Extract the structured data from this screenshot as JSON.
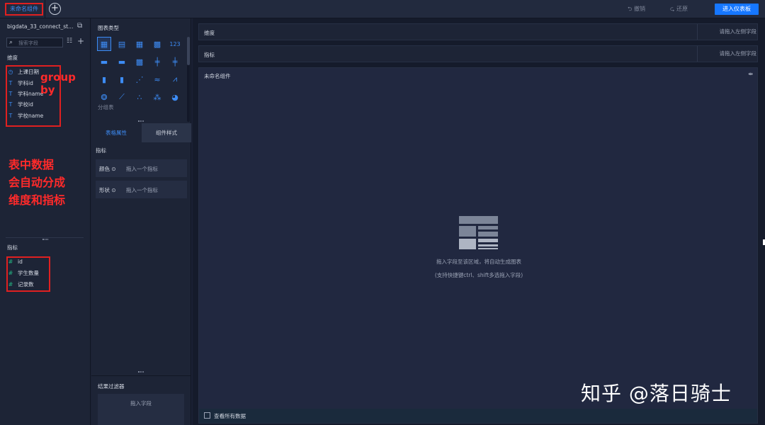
{
  "topbar": {
    "active_tab": "未命名组件",
    "add_tab_icon": "+",
    "undo_label": "撤销",
    "redo_label": "还原",
    "enter_dashboard_label": "进入仪表板"
  },
  "left": {
    "dataset_name": "bigdata_33_connect_stud...",
    "search_placeholder": "搜索字段",
    "dimension_title": "维度",
    "dimensions": [
      {
        "label": "上课日期",
        "icon": "clock-icon"
      },
      {
        "label": "学科id",
        "icon": "text-type-icon"
      },
      {
        "label": "学科name",
        "icon": "text-type-icon"
      },
      {
        "label": "学校id",
        "icon": "text-type-icon"
      },
      {
        "label": "学校name",
        "icon": "text-type-icon"
      }
    ],
    "measure_title": "指标",
    "measures": [
      {
        "label": "id",
        "icon": "number-type-icon"
      },
      {
        "label": "学生数量",
        "icon": "number-type-icon"
      },
      {
        "label": "记录数",
        "icon": "number-type-icon"
      }
    ],
    "annotation_groupby": "group by",
    "annotation_note": [
      "表中数据",
      "会自动分成",
      "维度和指标"
    ]
  },
  "middle": {
    "chart_type_title": "图表类型",
    "chart_types": [
      {
        "icon": "group-table-icon",
        "glyph": "▦",
        "selected": true
      },
      {
        "icon": "detail-table-icon",
        "glyph": "▤",
        "selected": false
      },
      {
        "icon": "cross-table-icon",
        "glyph": "▦",
        "selected": false
      },
      {
        "icon": "color-table-icon",
        "glyph": "▩",
        "selected": false
      },
      {
        "icon": "kpi-icon",
        "glyph": "123",
        "selected": false
      },
      {
        "icon": "gantt-icon",
        "glyph": "▬",
        "selected": false
      },
      {
        "icon": "heat-table-icon",
        "glyph": "▬",
        "selected": false
      },
      {
        "icon": "heatmap-icon",
        "glyph": "▩",
        "selected": false
      },
      {
        "icon": "boxplot-icon",
        "glyph": "╪",
        "selected": false
      },
      {
        "icon": "candle-icon",
        "glyph": "╪",
        "selected": false
      },
      {
        "icon": "bar-chart-icon",
        "glyph": "▮",
        "selected": false
      },
      {
        "icon": "stacked-bar-icon",
        "glyph": "▮",
        "selected": false
      },
      {
        "icon": "scatter-bar-icon",
        "glyph": "⋰",
        "selected": false
      },
      {
        "icon": "multi-line-icon",
        "glyph": "≈",
        "selected": false
      },
      {
        "icon": "line-chart-icon",
        "glyph": "⩘",
        "selected": false
      },
      {
        "icon": "radar-icon",
        "glyph": "❂",
        "selected": false
      },
      {
        "icon": "area-chart-icon",
        "glyph": "⟋",
        "selected": false
      },
      {
        "icon": "scatter-icon",
        "glyph": "∴",
        "selected": false
      },
      {
        "icon": "bubble-icon",
        "glyph": "⁂",
        "selected": false
      },
      {
        "icon": "pie-chart-icon",
        "glyph": "◕",
        "selected": false
      }
    ],
    "selected_chart_name": "分组表",
    "tab_table_props": "表格属性",
    "tab_component_style": "组件样式",
    "measure_section": "指标",
    "color_label": "颜色",
    "color_drop": "拖入一个指标",
    "shape_label": "形状",
    "shape_drop": "拖入一个指标",
    "filter_title": "结果过滤器",
    "filter_drop": "拖入字段"
  },
  "main": {
    "dimension_slot_label": "维度",
    "dimension_slot_hint": "请拖入左侧字段",
    "measure_slot_label": "指标",
    "measure_slot_hint": "请拖入左侧字段",
    "canvas_title": "未命名组件",
    "placeholder_text": "拖入字段至该区域，将自动生成图表",
    "placeholder_subtext": "(支持快捷键ctrl、shift多选拖入字段)",
    "view_all_label": "查看所有数据",
    "watermark": "知乎 @落日骑士"
  },
  "colors": {
    "accent": "#3d8cf5",
    "primary_button": "#1677ff",
    "annotation_red": "#e02020",
    "measure_green": "#25b482"
  }
}
